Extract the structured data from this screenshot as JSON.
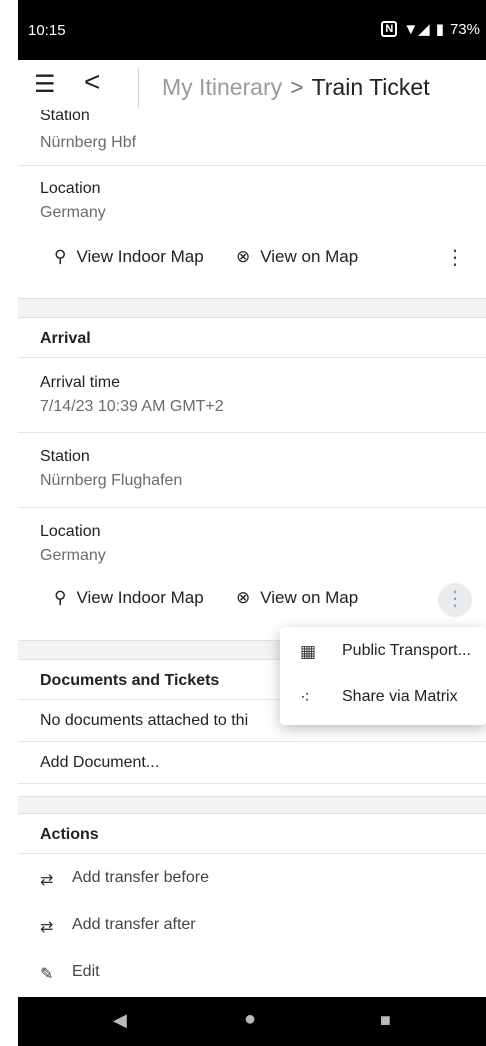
{
  "status": {
    "time": "10:15",
    "nfc": "N",
    "signal": "▼◢",
    "battery": "73%"
  },
  "appbar": {
    "menu_icon": "☰",
    "back_icon": "<",
    "breadcrumb_parent": "My Itinerary",
    "breadcrumb_arrow": ">",
    "breadcrumb_current": "Train Ticket"
  },
  "departure": {
    "station_label": "Station",
    "station_value": "Nürnberg Hbf",
    "location_label": "Location",
    "location_value": "Germany",
    "indoor_map": "View Indoor Map",
    "view_map": "View on Map"
  },
  "arrival": {
    "header": "Arrival",
    "time_label": "Arrival time",
    "time_value": "7/14/23 10:39 AM GMT+2",
    "station_label": "Station",
    "station_value": "Nürnberg Flughafen",
    "location_label": "Location",
    "location_value": "Germany",
    "indoor_map": "View Indoor Map",
    "view_map": "View on Map"
  },
  "documents": {
    "header": "Documents and Tickets",
    "empty_text": "No documents attached to thi",
    "add": "Add Document..."
  },
  "actions": {
    "header": "Actions",
    "items": [
      {
        "icon": "⇄",
        "label": "Add transfer before"
      },
      {
        "icon": "⇄",
        "label": "Add transfer after"
      },
      {
        "icon": "✎",
        "label": "Edit"
      }
    ]
  },
  "popup": {
    "items": [
      {
        "icon": "calendar-icon",
        "label": "Public Transport..."
      },
      {
        "icon": "share-icon",
        "label": "Share via Matrix"
      }
    ]
  }
}
